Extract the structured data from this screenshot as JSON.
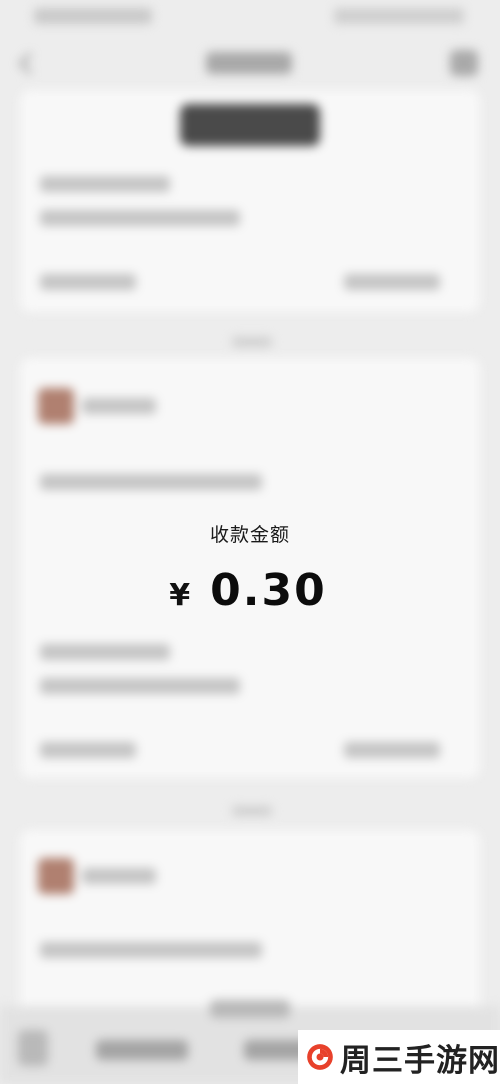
{
  "overlay": {
    "label": "收款金额",
    "currency": "¥",
    "amount": "0.30"
  },
  "watermark": {
    "text": "周三手游网",
    "colors": {
      "red": "#e8412b",
      "dark": "#2b2b2b"
    }
  },
  "icons": [
    "back-arrow-icon",
    "more-icon",
    "keyboard-icon",
    "avatar-icon",
    "logo-icon"
  ]
}
